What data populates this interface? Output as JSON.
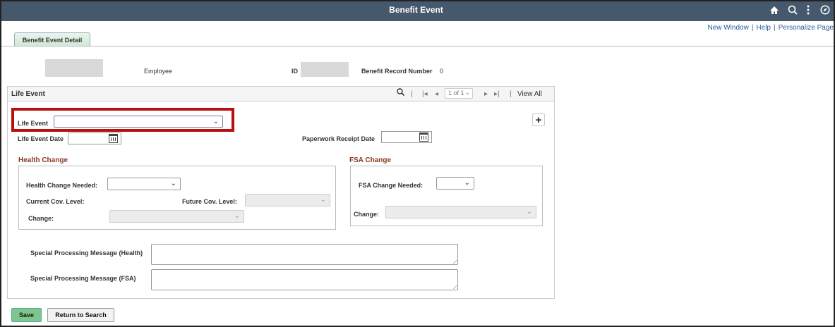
{
  "header": {
    "title": "Benefit Event",
    "icons": [
      "home-icon",
      "search-icon",
      "more-icon",
      "navbar-icon"
    ]
  },
  "links": {
    "new_window": "New Window",
    "help": "Help",
    "personalize": "Personalize Page"
  },
  "tabs": [
    {
      "label": "Benefit Event Detail",
      "active": true
    }
  ],
  "employee": {
    "employee_label": "Employee",
    "id_label": "ID",
    "record_label": "Benefit Record Number",
    "record_value": "0"
  },
  "panel": {
    "title": "Life Event",
    "pager": {
      "range": "1 of 1",
      "view_all": "View All"
    }
  },
  "life_event": {
    "label": "Life Event",
    "value": "",
    "date_label": "Life Event Date",
    "paperwork_label": "Paperwork Receipt Date"
  },
  "health": {
    "title": "Health Change",
    "needed_label": "Health Change Needed:",
    "current_label": "Current Cov. Level:",
    "future_label": "Future Cov. Level:",
    "change_label": "Change:"
  },
  "fsa": {
    "title": "FSA Change",
    "needed_label": "FSA Change Needed:",
    "change_label": "Change:"
  },
  "messages": {
    "health_label": "Special Processing Message (Health)",
    "fsa_label": "Special Processing Message (FSA)"
  },
  "buttons": {
    "save": "Save",
    "return": "Return to Search"
  },
  "colors": {
    "banner": "#46586b",
    "section_title": "#8a3b1e",
    "highlight": "#b80f0f",
    "save_button": "#7fc68d"
  }
}
